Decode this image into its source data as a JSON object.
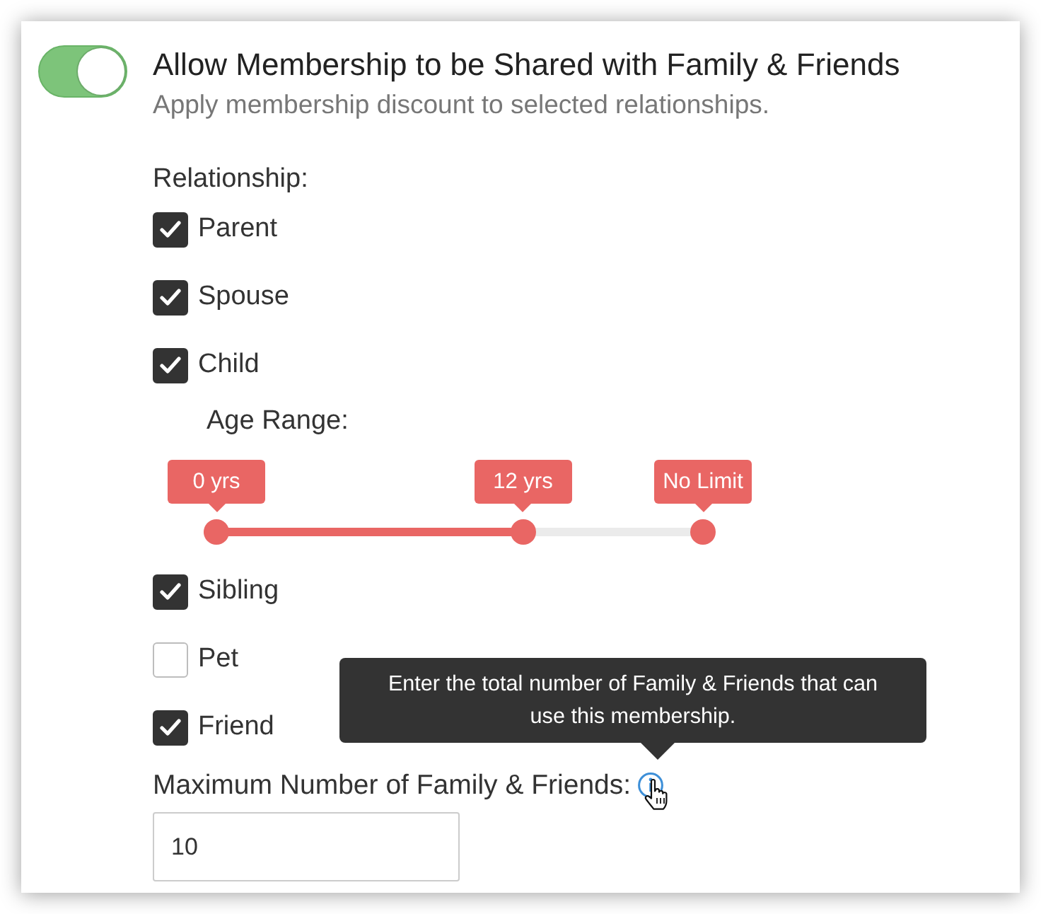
{
  "setting": {
    "on": true,
    "title": "Allow Membership to be Shared with Family & Friends",
    "description": "Apply membership discount to selected relationships."
  },
  "relationship": {
    "label": "Relationship:",
    "options": [
      {
        "label": "Parent",
        "checked": true
      },
      {
        "label": "Spouse",
        "checked": true
      },
      {
        "label": "Child",
        "checked": true,
        "age_range": {
          "label": "Age Range:",
          "handles": [
            {
              "label": "0 yrs",
              "level": 0
            },
            {
              "label": "12 yrs",
              "level": 0.63
            },
            {
              "label": "No Limit",
              "level": 1
            }
          ]
        }
      },
      {
        "label": "Sibling",
        "checked": true
      },
      {
        "label": "Pet",
        "checked": false
      },
      {
        "label": "Friend",
        "checked": true
      }
    ]
  },
  "max_friends": {
    "label": "Maximum Number of Family & Friends:",
    "value": "10",
    "tooltip": "Enter the total number of Family & Friends that can use this membership."
  }
}
